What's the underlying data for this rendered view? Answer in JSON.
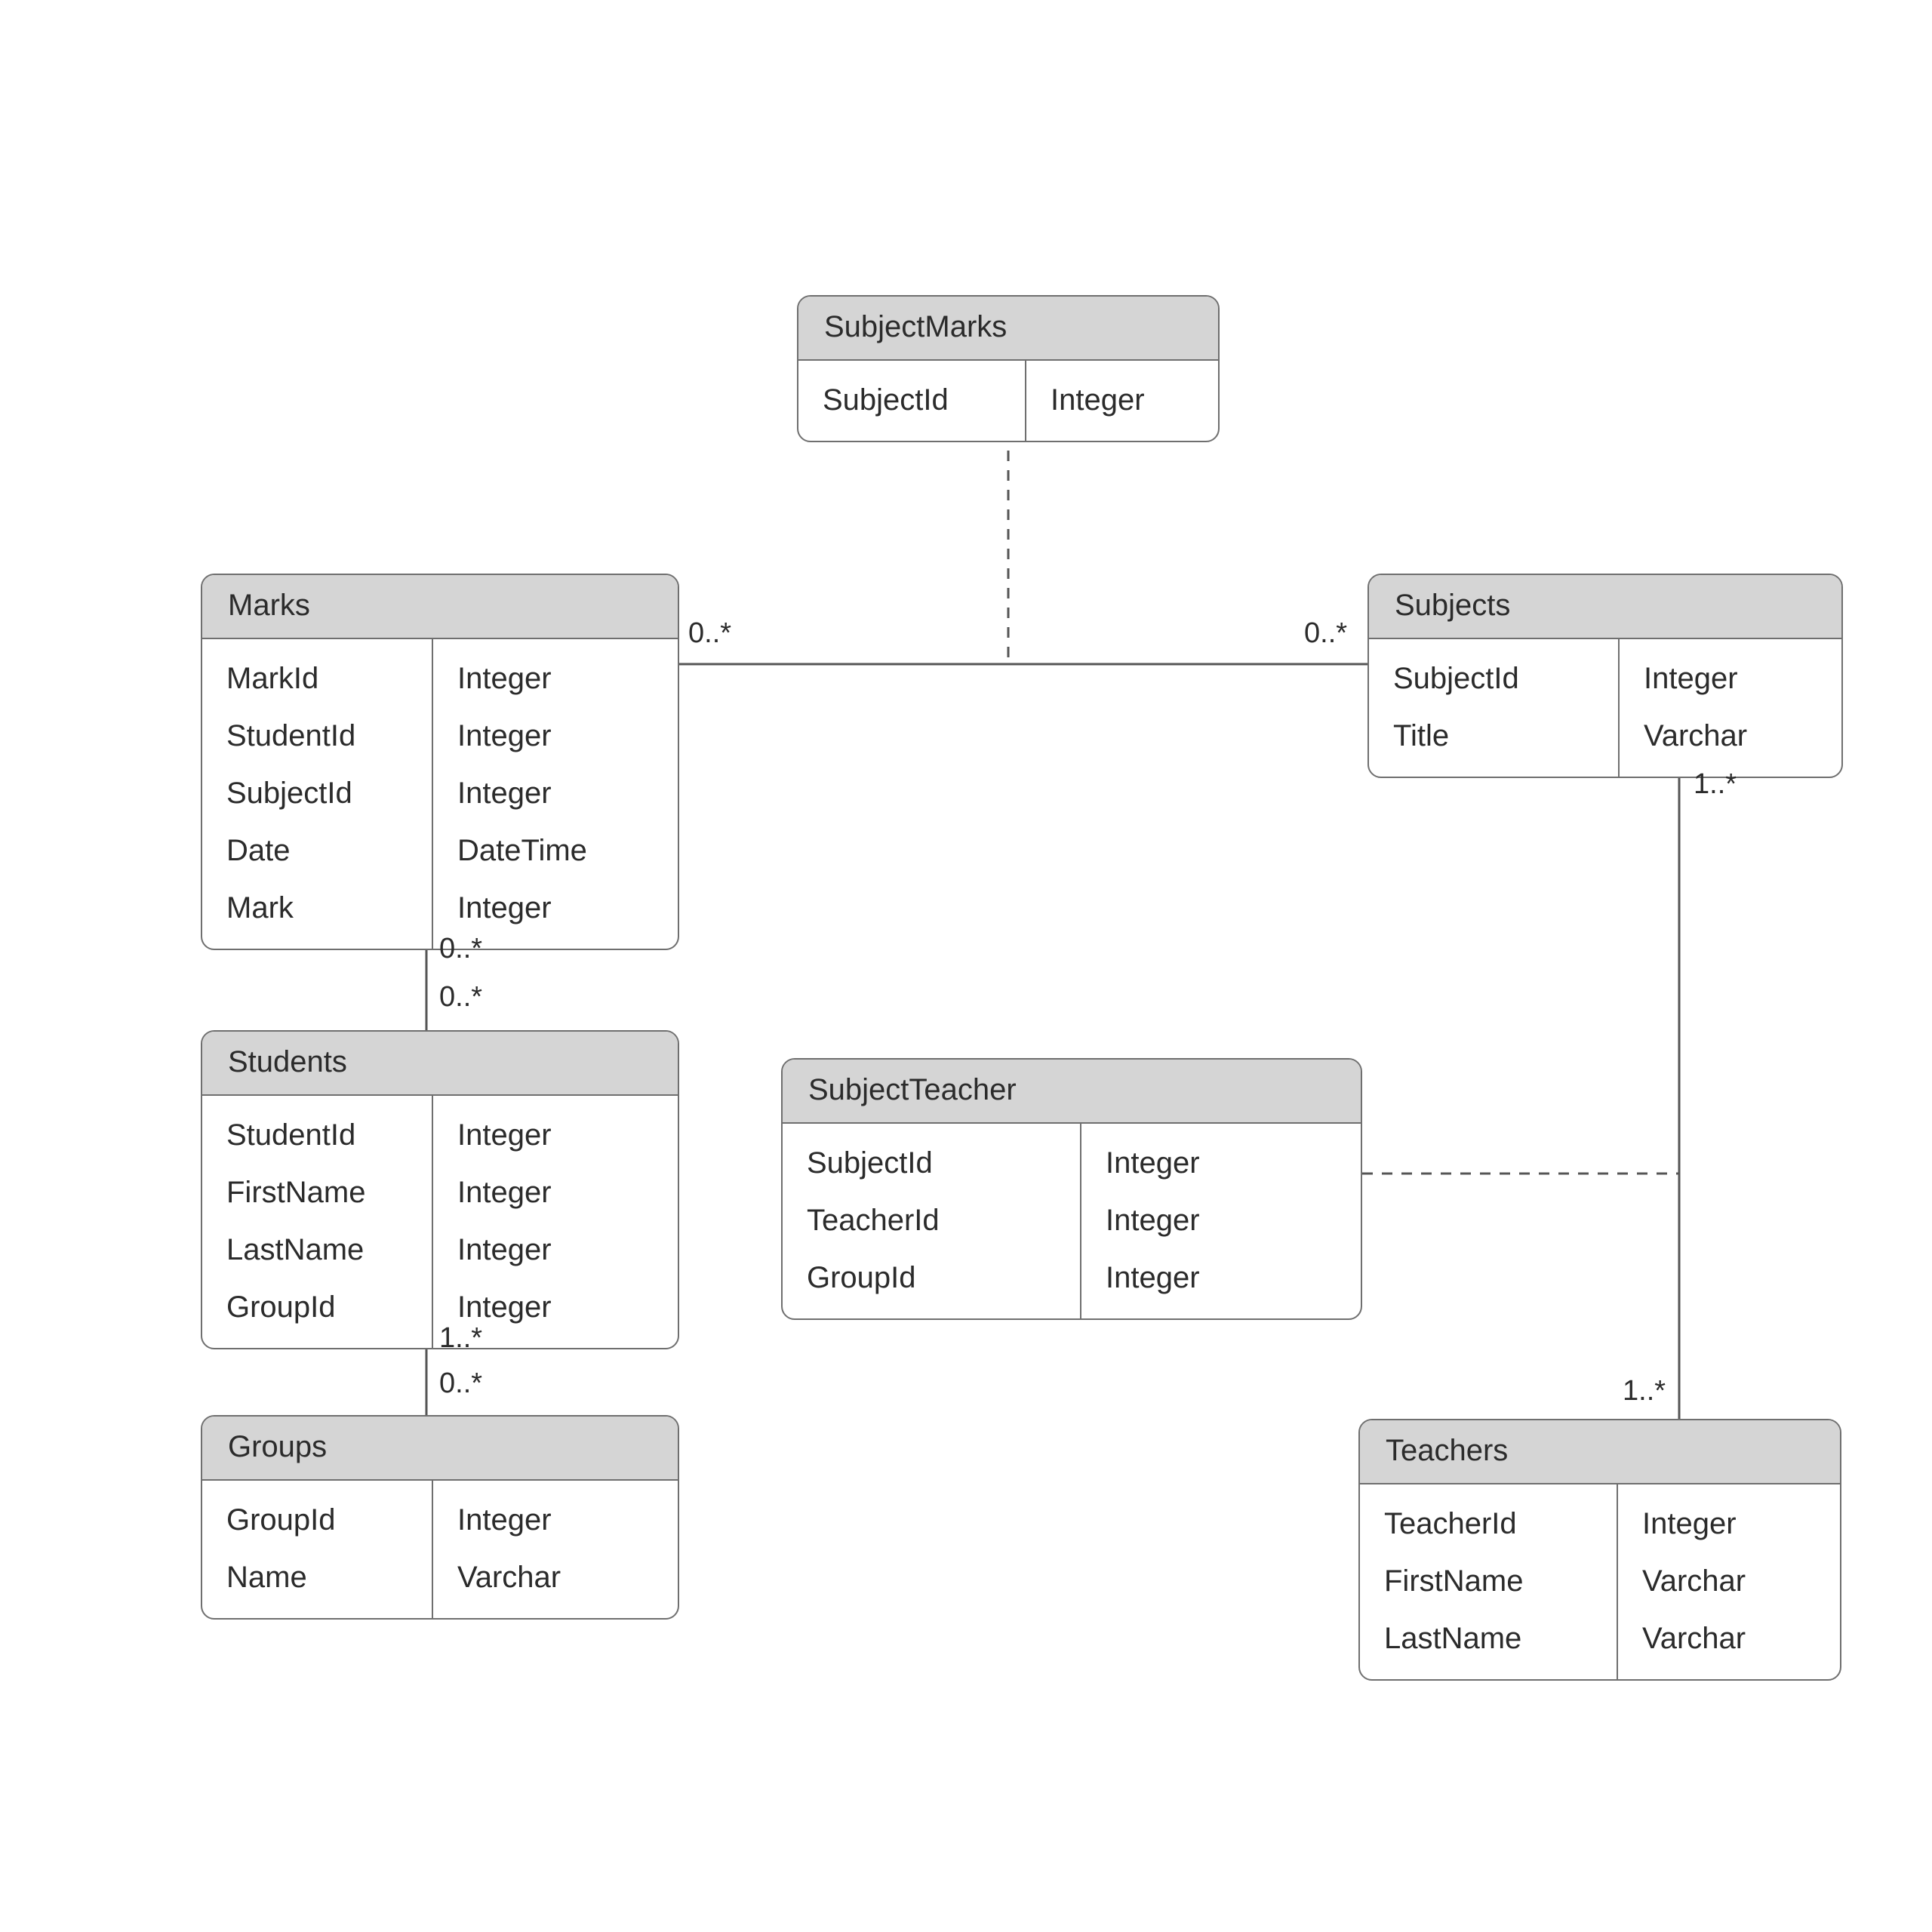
{
  "entities": {
    "subjectMarks": {
      "title": "SubjectMarks",
      "columns": [
        "SubjectId"
      ],
      "types": [
        "Integer"
      ]
    },
    "marks": {
      "title": "Marks",
      "columns": [
        "MarkId",
        "StudentId",
        "SubjectId",
        "Date",
        "Mark"
      ],
      "types": [
        "Integer",
        "Integer",
        "Integer",
        "DateTime",
        "Integer"
      ]
    },
    "subjects": {
      "title": "Subjects",
      "columns": [
        "SubjectId",
        "Title"
      ],
      "types": [
        "Integer",
        "Varchar"
      ]
    },
    "students": {
      "title": "Students",
      "columns": [
        "StudentId",
        "FirstName",
        "LastName",
        "GroupId"
      ],
      "types": [
        "Integer",
        "Integer",
        "Integer",
        "Integer"
      ]
    },
    "subjectTeacher": {
      "title": "SubjectTeacher",
      "columns": [
        "SubjectId",
        "TeacherId",
        "GroupId"
      ],
      "types": [
        "Integer",
        "Integer",
        "Integer"
      ]
    },
    "groups": {
      "title": "Groups",
      "columns": [
        "GroupId",
        "Name"
      ],
      "types": [
        "Integer",
        "Varchar"
      ]
    },
    "teachers": {
      "title": "Teachers",
      "columns": [
        "TeacherId",
        "FirstName",
        "LastName"
      ],
      "types": [
        "Integer",
        "Varchar",
        "Varchar"
      ]
    }
  },
  "multiplicities": {
    "marksToSubjects_left": "0..*",
    "marksToSubjects_right": "0..*",
    "marksToStudents_top": "0..*",
    "marksToStudents_bottom": "0..*",
    "studentsToGroups_top": "1..*",
    "studentsToGroups_bottom": "0..*",
    "subjectsToTeachers_top": "1..*",
    "subjectsToTeachers_bottom": "1..*"
  }
}
